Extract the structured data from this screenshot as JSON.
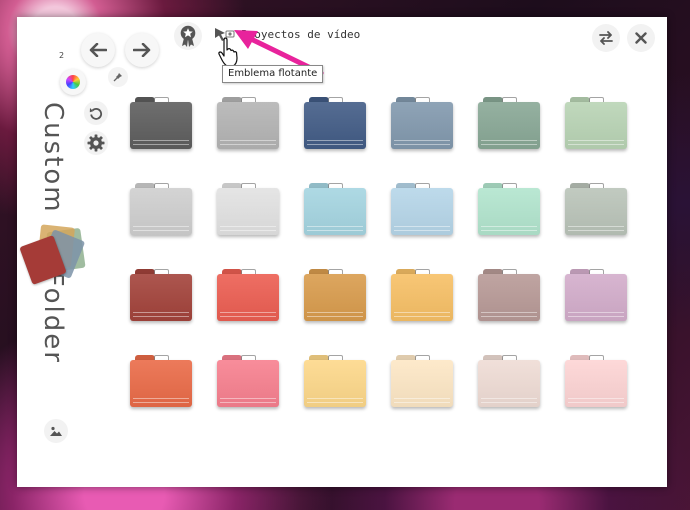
{
  "app": {
    "title_part1": "Custom",
    "title_part2": "Folder",
    "counter": "2",
    "path": "Proyectos de vídeo",
    "tooltip": "Emblema flotante",
    "accent_arrow_color": "#e8239c"
  },
  "toolbar": {
    "back_icon": "arrow-left-icon",
    "forward_icon": "arrow-right-icon",
    "color_wheel_icon": "color-wheel-icon",
    "pin_icon": "pin-icon",
    "undo_icon": "undo-icon",
    "settings_icon": "gear-icon",
    "emblem_icon": "star-medal-icon",
    "swap_icon": "swap-arrows-icon",
    "close_icon": "close-icon",
    "image_icon": "image-icon"
  },
  "folders": [
    [
      "#5e5e5e",
      "#b4b4b4",
      "#425c86",
      "#8299ae",
      "#89a896",
      "#b9d4b5"
    ],
    [
      "#cfcfcf",
      "#e2e2e2",
      "#a5d5e1",
      "#b6d6e9",
      "#b2e5ce",
      "#bac4b9"
    ],
    [
      "#a3433b",
      "#ec5e52",
      "#d99c4d",
      "#f7c066",
      "#b89a97",
      "#d3adcb"
    ],
    [
      "#ea6b48",
      "#f7808f",
      "#fdd88a",
      "#fde7c5",
      "#efdcd5",
      "#fdd4d4"
    ]
  ]
}
